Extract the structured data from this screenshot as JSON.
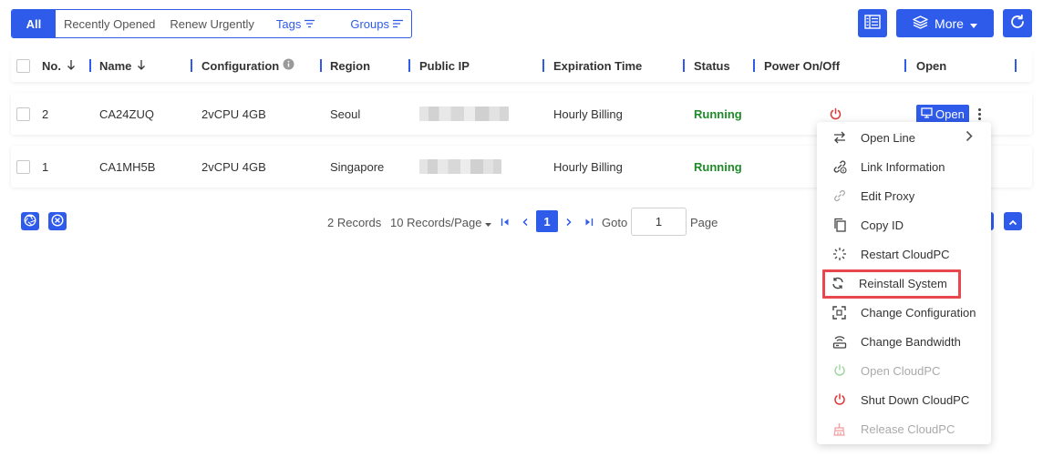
{
  "filters": {
    "all": "All",
    "recently_opened": "Recently Opened",
    "renew_urgently": "Renew Urgently",
    "tags": "Tags",
    "groups": "Groups"
  },
  "toolbar": {
    "more_label": "More",
    "layout_icon": "list-layout-icon",
    "refresh_icon": "refresh-icon"
  },
  "table": {
    "headers": {
      "no": "No.",
      "name": "Name",
      "configuration": "Configuration",
      "region": "Region",
      "public_ip": "Public IP",
      "expiration_time": "Expiration Time",
      "status": "Status",
      "power": "Power On/Off",
      "open": "Open"
    },
    "rows": [
      {
        "no": "2",
        "name": "CA24ZUQ",
        "configuration": "2vCPU 4GB",
        "region": "Seoul",
        "expiration": "Hourly Billing",
        "status": "Running",
        "open_label": "Open"
      },
      {
        "no": "1",
        "name": "CA1MH5B",
        "configuration": "2vCPU 4GB",
        "region": "Singapore",
        "expiration": "Hourly Billing",
        "status": "Running"
      }
    ]
  },
  "pagination": {
    "records": "2 Records",
    "page_size": "10 Records/Page",
    "current_page": "1",
    "goto_label": "Goto",
    "goto_value": "1",
    "page_label": "Page"
  },
  "menu": {
    "items": [
      {
        "label": "Open Line",
        "icon": "swap-arrows-icon",
        "disabled": false
      },
      {
        "label": "Link Information",
        "icon": "link-info-icon",
        "disabled": false
      },
      {
        "label": "Edit Proxy",
        "icon": "chain-link-icon",
        "disabled": false
      },
      {
        "label": "Copy ID",
        "icon": "copy-icon",
        "disabled": false
      },
      {
        "label": "Restart CloudPC",
        "icon": "loading-spinner-icon",
        "disabled": false
      },
      {
        "label": "Reinstall System",
        "icon": "reinstall-icon",
        "disabled": false
      },
      {
        "label": "Change Configuration",
        "icon": "resize-icon",
        "disabled": false
      },
      {
        "label": "Change Bandwidth",
        "icon": "router-icon",
        "disabled": false
      },
      {
        "label": "Open CloudPC",
        "icon": "power-icon",
        "disabled": true
      },
      {
        "label": "Shut Down CloudPC",
        "icon": "power-icon",
        "disabled": false
      },
      {
        "label": "Release CloudPC",
        "icon": "broom-icon",
        "disabled": true
      }
    ]
  },
  "colors": {
    "primary": "#2f5bea",
    "running": "#1e8a28",
    "danger": "#e8474d",
    "power_red": "#e03535"
  }
}
